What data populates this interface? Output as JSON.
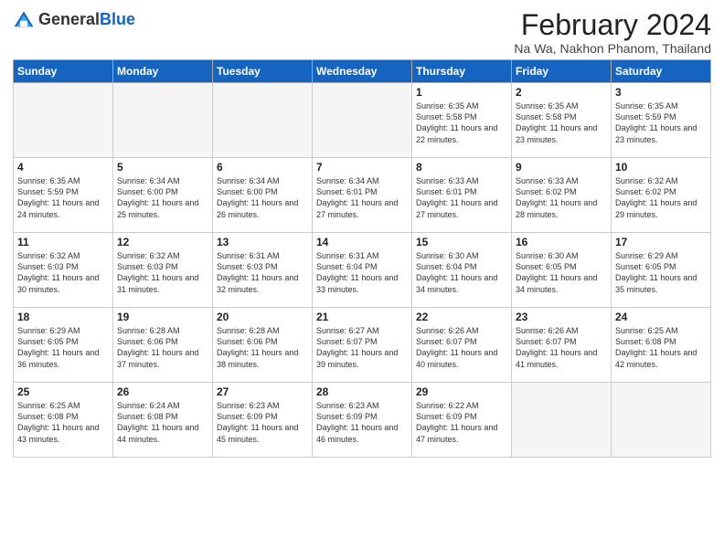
{
  "header": {
    "logo_general": "General",
    "logo_blue": "Blue",
    "month_title": "February 2024",
    "subtitle": "Na Wa, Nakhon Phanom, Thailand"
  },
  "weekdays": [
    "Sunday",
    "Monday",
    "Tuesday",
    "Wednesday",
    "Thursday",
    "Friday",
    "Saturday"
  ],
  "weeks": [
    [
      {
        "day": "",
        "info": ""
      },
      {
        "day": "",
        "info": ""
      },
      {
        "day": "",
        "info": ""
      },
      {
        "day": "",
        "info": ""
      },
      {
        "day": "1",
        "info": "Sunrise: 6:35 AM\nSunset: 5:58 PM\nDaylight: 11 hours and 22 minutes."
      },
      {
        "day": "2",
        "info": "Sunrise: 6:35 AM\nSunset: 5:58 PM\nDaylight: 11 hours and 23 minutes."
      },
      {
        "day": "3",
        "info": "Sunrise: 6:35 AM\nSunset: 5:59 PM\nDaylight: 11 hours and 23 minutes."
      }
    ],
    [
      {
        "day": "4",
        "info": "Sunrise: 6:35 AM\nSunset: 5:59 PM\nDaylight: 11 hours and 24 minutes."
      },
      {
        "day": "5",
        "info": "Sunrise: 6:34 AM\nSunset: 6:00 PM\nDaylight: 11 hours and 25 minutes."
      },
      {
        "day": "6",
        "info": "Sunrise: 6:34 AM\nSunset: 6:00 PM\nDaylight: 11 hours and 26 minutes."
      },
      {
        "day": "7",
        "info": "Sunrise: 6:34 AM\nSunset: 6:01 PM\nDaylight: 11 hours and 27 minutes."
      },
      {
        "day": "8",
        "info": "Sunrise: 6:33 AM\nSunset: 6:01 PM\nDaylight: 11 hours and 27 minutes."
      },
      {
        "day": "9",
        "info": "Sunrise: 6:33 AM\nSunset: 6:02 PM\nDaylight: 11 hours and 28 minutes."
      },
      {
        "day": "10",
        "info": "Sunrise: 6:32 AM\nSunset: 6:02 PM\nDaylight: 11 hours and 29 minutes."
      }
    ],
    [
      {
        "day": "11",
        "info": "Sunrise: 6:32 AM\nSunset: 6:03 PM\nDaylight: 11 hours and 30 minutes."
      },
      {
        "day": "12",
        "info": "Sunrise: 6:32 AM\nSunset: 6:03 PM\nDaylight: 11 hours and 31 minutes."
      },
      {
        "day": "13",
        "info": "Sunrise: 6:31 AM\nSunset: 6:03 PM\nDaylight: 11 hours and 32 minutes."
      },
      {
        "day": "14",
        "info": "Sunrise: 6:31 AM\nSunset: 6:04 PM\nDaylight: 11 hours and 33 minutes."
      },
      {
        "day": "15",
        "info": "Sunrise: 6:30 AM\nSunset: 6:04 PM\nDaylight: 11 hours and 34 minutes."
      },
      {
        "day": "16",
        "info": "Sunrise: 6:30 AM\nSunset: 6:05 PM\nDaylight: 11 hours and 34 minutes."
      },
      {
        "day": "17",
        "info": "Sunrise: 6:29 AM\nSunset: 6:05 PM\nDaylight: 11 hours and 35 minutes."
      }
    ],
    [
      {
        "day": "18",
        "info": "Sunrise: 6:29 AM\nSunset: 6:05 PM\nDaylight: 11 hours and 36 minutes."
      },
      {
        "day": "19",
        "info": "Sunrise: 6:28 AM\nSunset: 6:06 PM\nDaylight: 11 hours and 37 minutes."
      },
      {
        "day": "20",
        "info": "Sunrise: 6:28 AM\nSunset: 6:06 PM\nDaylight: 11 hours and 38 minutes."
      },
      {
        "day": "21",
        "info": "Sunrise: 6:27 AM\nSunset: 6:07 PM\nDaylight: 11 hours and 39 minutes."
      },
      {
        "day": "22",
        "info": "Sunrise: 6:26 AM\nSunset: 6:07 PM\nDaylight: 11 hours and 40 minutes."
      },
      {
        "day": "23",
        "info": "Sunrise: 6:26 AM\nSunset: 6:07 PM\nDaylight: 11 hours and 41 minutes."
      },
      {
        "day": "24",
        "info": "Sunrise: 6:25 AM\nSunset: 6:08 PM\nDaylight: 11 hours and 42 minutes."
      }
    ],
    [
      {
        "day": "25",
        "info": "Sunrise: 6:25 AM\nSunset: 6:08 PM\nDaylight: 11 hours and 43 minutes."
      },
      {
        "day": "26",
        "info": "Sunrise: 6:24 AM\nSunset: 6:08 PM\nDaylight: 11 hours and 44 minutes."
      },
      {
        "day": "27",
        "info": "Sunrise: 6:23 AM\nSunset: 6:09 PM\nDaylight: 11 hours and 45 minutes."
      },
      {
        "day": "28",
        "info": "Sunrise: 6:23 AM\nSunset: 6:09 PM\nDaylight: 11 hours and 46 minutes."
      },
      {
        "day": "29",
        "info": "Sunrise: 6:22 AM\nSunset: 6:09 PM\nDaylight: 11 hours and 47 minutes."
      },
      {
        "day": "",
        "info": ""
      },
      {
        "day": "",
        "info": ""
      }
    ]
  ]
}
